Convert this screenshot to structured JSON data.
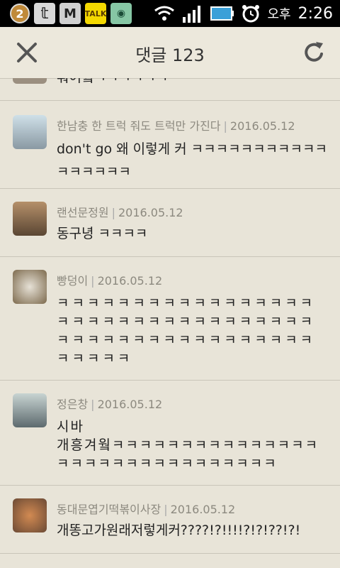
{
  "status_bar": {
    "notification_count": "2",
    "talk_label": "TALK",
    "time_prefix": "오후",
    "time": "2:26"
  },
  "header": {
    "title": "댓글 123"
  },
  "comments": [
    {
      "author": "",
      "date": "",
      "text": "훠어웤ㅋㅋㅋㅋㅋㅋ"
    },
    {
      "author": "한남충 한 트럭 줘도 트럭만 가진다",
      "date": "2016.05.12",
      "text": "don't go 왜 이렇게 커 ㅋㅋㅋㅋㅋㅋㅋㅋㅋㅋㅋㅋㅋㅋㅋㅋㅋ"
    },
    {
      "author": "랜선문정원",
      "date": "2016.05.12",
      "text": "동구녕 ㅋㅋㅋㅋ"
    },
    {
      "author": "빵덩이",
      "date": "2016.05.12",
      "text": "ㅋㅋㅋㅋㅋㅋㅋㅋㅋㅋㅋㅋㅋㅋㅋㅋㅋㅋㅋㅋㅋㅋㅋㅋㅋㅋㅋㅋㅋㅋㅋㅋㅋㅋㅋㅋㅋㅋㅋㅋㅋㅋㅋㅋㅋㅋㅋㅋㅋㅋㅋㅋㅋㅋㅋㅋ"
    },
    {
      "author": "정은창",
      "date": "2016.05.12",
      "text": "시바\n개흥겨웤ㅋㅋㅋㅋㅋㅋㅋㅋㅋㅋㅋㅋㅋㅋㅋㅋㅋㅋㅋㅋㅋㅋㅋㅋㅋㅋㅋㅋㅋㅋㅋ"
    },
    {
      "author": "동대문엽기떡볶이사장",
      "date": "2016.05.12",
      "text": "개똥고가원래저렇게커????!?!!!!?!?!??!?!"
    }
  ]
}
